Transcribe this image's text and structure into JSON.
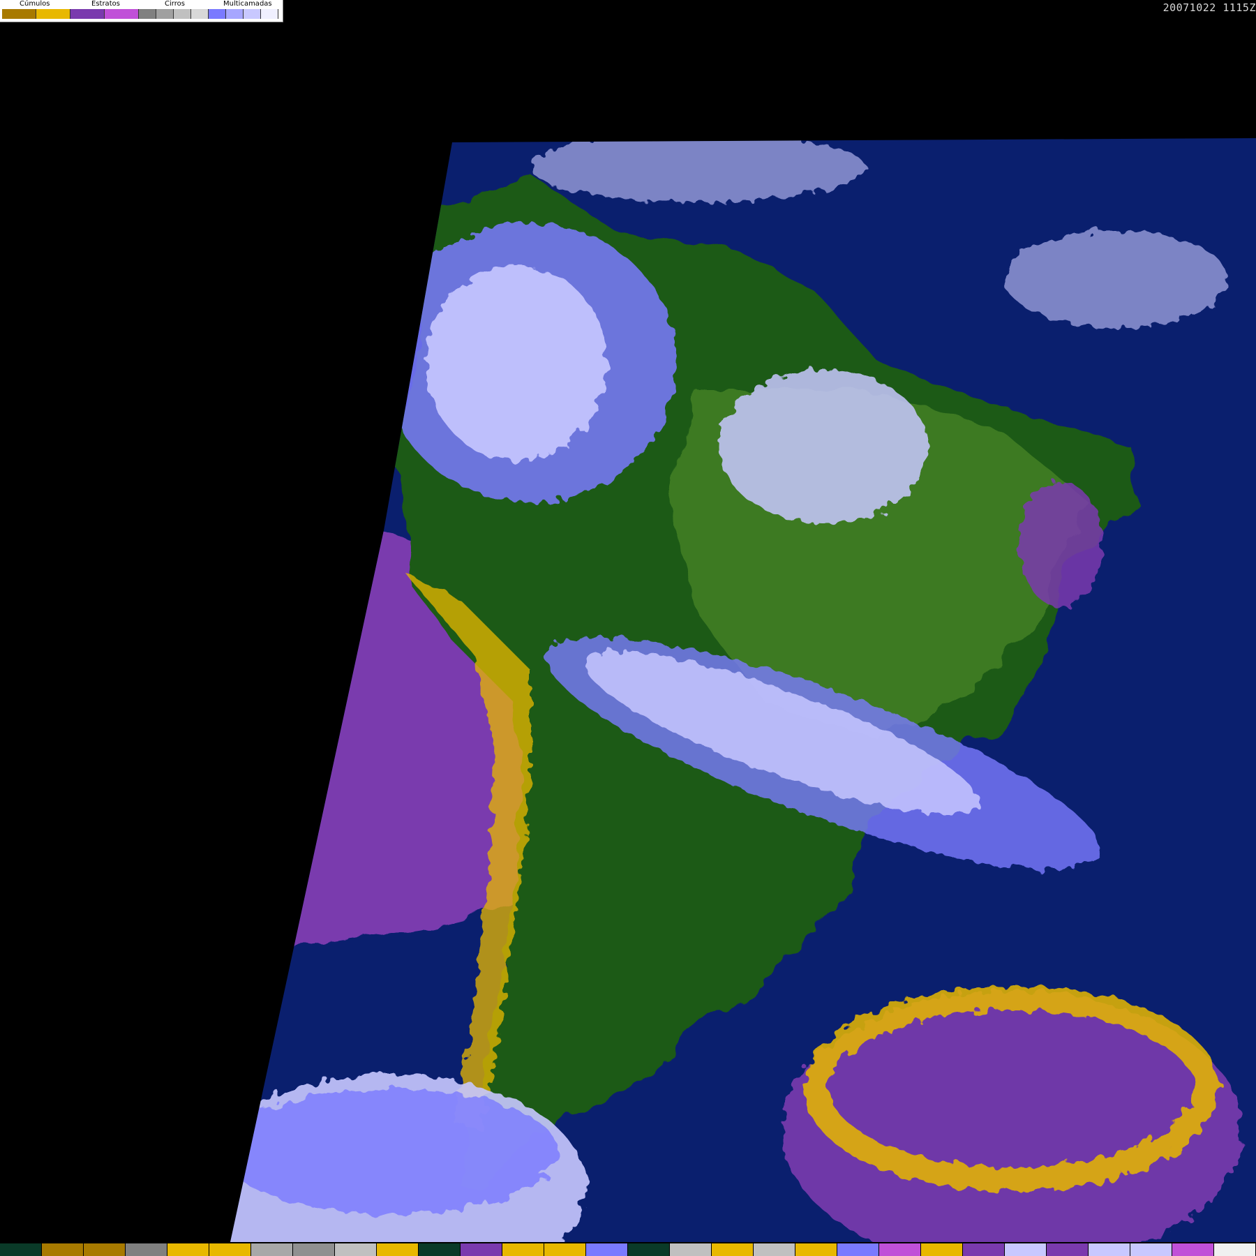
{
  "legend": {
    "categories": [
      {
        "label": "Cúmulos",
        "colors": [
          "#a87a00",
          "#e8b800"
        ]
      },
      {
        "label": "Estratos",
        "colors": [
          "#7a3aae",
          "#c050d8"
        ]
      },
      {
        "label": "Cirros",
        "colors": [
          "#808080",
          "#a0a0a0",
          "#c0c0c0",
          "#d8d8d8"
        ]
      },
      {
        "label": "Multicamadas",
        "colors": [
          "#7a7aff",
          "#a6a6ff",
          "#c8c8ff",
          "#f0f0ff"
        ]
      }
    ]
  },
  "timestamp": "20071022 1115Z",
  "colors": {
    "background": "#000000",
    "ocean": "#0a1f6e",
    "land_forest": "#1e5a14",
    "land_green": "#3e7a24",
    "stratus_sea": "#7a3aae",
    "cumulus_dark": "#a87a00",
    "cumulus_light": "#e8b800",
    "stratus_pink": "#c050d8",
    "cirrus_grey": "#a8a8a8",
    "multilayer_blue": "#7a7aff",
    "multilayer_light": "#c8c8ff"
  },
  "bottom_strip": [
    "#0a3a28",
    "#a87a00",
    "#a87a00",
    "#808080",
    "#e8b800",
    "#e8b800",
    "#a8a8a8",
    "#909090",
    "#c0c0c0",
    "#e8b800",
    "#0a3a28",
    "#7a3aae",
    "#e8b800",
    "#e8b800",
    "#7a7aff",
    "#0a3a28",
    "#c0c0c0",
    "#e8b800",
    "#c0c0c0",
    "#e8b800",
    "#7a7aff",
    "#c050d8",
    "#e8b800",
    "#7a3aae",
    "#c8c8ff",
    "#7a3aae",
    "#c8c8ff",
    "#c8c8ff",
    "#c050d8",
    "#f0f0f0"
  ]
}
